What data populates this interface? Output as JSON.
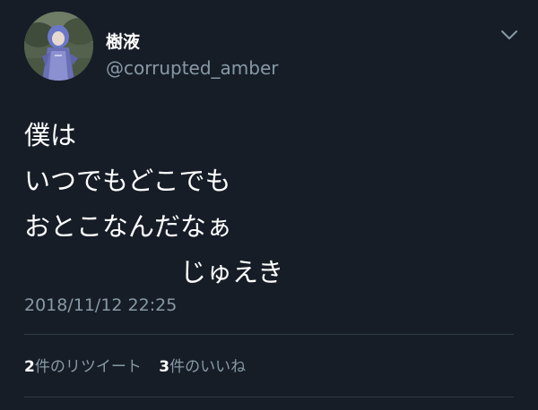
{
  "user": {
    "display_name": "樹液",
    "handle": "@corrupted_amber"
  },
  "header": {
    "menu_icon": "chevron-down-icon"
  },
  "tweet": {
    "lines": [
      "僕は",
      "いつでもどこでも",
      "おとこなんだなぁ",
      "　　　　　　じゅえき"
    ],
    "timestamp": "2018/11/12 22:25"
  },
  "stats": {
    "retweets_count": "2",
    "retweets_label": "件のリツイート",
    "likes_count": "3",
    "likes_label": "件のいいね"
  },
  "colors": {
    "background": "#161d27",
    "text": "#ffffff",
    "secondary": "#8899a6",
    "divider": "#2f3a46"
  }
}
